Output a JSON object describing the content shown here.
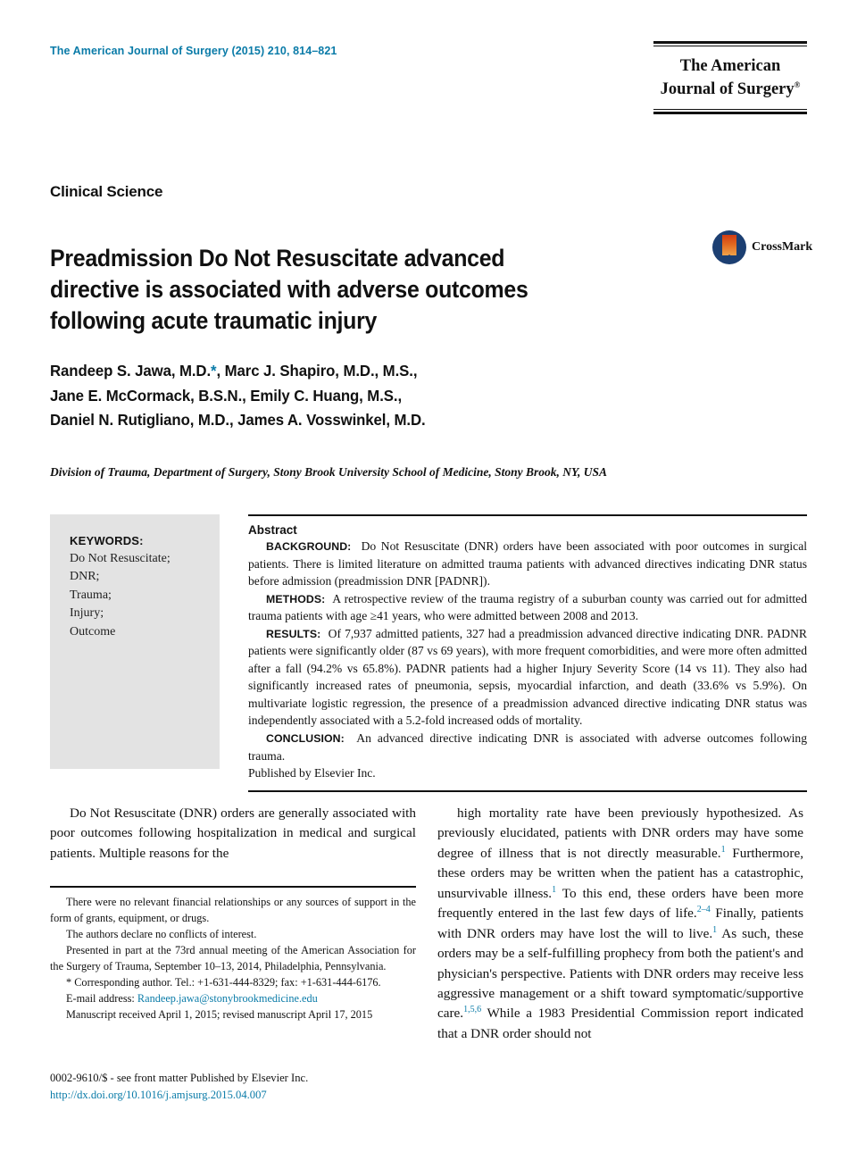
{
  "masthead": {
    "running_head": "The American Journal of Surgery (2015) 210, 814–821",
    "logo_line1": "The American",
    "logo_line2": "Journal of Surgery",
    "logo_registered": "®"
  },
  "article": {
    "section_label": "Clinical Science",
    "title": "Preadmission Do Not Resuscitate advanced directive is associated with adverse outcomes following acute traumatic injury",
    "authors_line1": "Randeep S. Jawa, M.D.",
    "authors_corr_marker": "*",
    "authors_line1_rest": ", Marc J. Shapiro, M.D., M.S.,",
    "authors_line2": "Jane E. McCormack, B.S.N., Emily C. Huang, M.S.,",
    "authors_line3": "Daniel N. Rutigliano, M.D., James A. Vosswinkel, M.D.",
    "affiliation": "Division of Trauma, Department of Surgery, Stony Brook University School of Medicine, Stony Brook, NY, USA"
  },
  "crossmark": {
    "label": "CrossMark"
  },
  "keywords": {
    "title": "KEYWORDS:",
    "items": [
      "Do Not Resuscitate;",
      "DNR;",
      "Trauma;",
      "Injury;",
      "Outcome"
    ]
  },
  "abstract": {
    "heading": "Abstract",
    "sections": [
      {
        "tag": "BACKGROUND:",
        "text": "Do Not Resuscitate (DNR) orders have been associated with poor outcomes in surgical patients. There is limited literature on admitted trauma patients with advanced directives indicating DNR status before admission (preadmission DNR [PADNR])."
      },
      {
        "tag": "METHODS:",
        "text": "A retrospective review of the trauma registry of a suburban county was carried out for admitted trauma patients with age ≥41 years, who were admitted between 2008 and 2013."
      },
      {
        "tag": "RESULTS:",
        "text": "Of 7,937 admitted patients, 327 had a preadmission advanced directive indicating DNR. PADNR patients were significantly older (87 vs 69 years), with more frequent comorbidities, and were more often admitted after a fall (94.2% vs 65.8%). PADNR patients had a higher Injury Severity Score (14 vs 11). They also had significantly increased rates of pneumonia, sepsis, myocardial infarction, and death (33.6% vs 5.9%). On multivariate logistic regression, the presence of a preadmission advanced directive indicating DNR status was independently associated with a 5.2-fold increased odds of mortality."
      },
      {
        "tag": "CONCLUSION:",
        "text": "An advanced directive indicating DNR is associated with adverse outcomes following trauma."
      }
    ],
    "publisher_line": "Published by Elsevier Inc."
  },
  "body": {
    "left_column": "Do Not Resuscitate (DNR) orders are generally associated with poor outcomes following hospitalization in medical and surgical patients. Multiple reasons for the",
    "right_column_parts": [
      {
        "type": "text",
        "value": "high mortality rate have been previously hypothesized. As previously elucidated, patients with DNR orders may have some degree of illness that is not directly measurable."
      },
      {
        "type": "cite",
        "value": "1"
      },
      {
        "type": "text",
        "value": " Furthermore, these orders may be written when the patient has a catastrophic, unsurvivable illness."
      },
      {
        "type": "cite",
        "value": "1"
      },
      {
        "type": "text",
        "value": " To this end, these orders have been more frequently entered in the last few days of life."
      },
      {
        "type": "cite",
        "value": "2–4"
      },
      {
        "type": "text",
        "value": " Finally, patients with DNR orders may have lost the will to live."
      },
      {
        "type": "cite",
        "value": "1"
      },
      {
        "type": "text",
        "value": " As such, these orders may be a self-fulfilling prophecy from both the patient's and physician's perspective. Patients with DNR orders may receive less aggressive management or a shift toward symptomatic/supportive care."
      },
      {
        "type": "cite",
        "value": "1,5,6"
      },
      {
        "type": "text",
        "value": " While a 1983 Presidential Commission report indicated that a DNR order should not"
      }
    ]
  },
  "footnotes": {
    "items": [
      "There were no relevant financial relationships or any sources of support in the form of grants, equipment, or drugs.",
      "The authors declare no conflicts of interest.",
      "Presented in part at the 73rd annual meeting of the American Association for the Surgery of Trauma, September 10–13, 2014, Philadelphia, Pennsylvania."
    ],
    "corresponding_marker": "*",
    "corresponding": "Corresponding author. Tel.: +1-631-444-8329; fax: +1-631-444-6176.",
    "email_label": "E-mail address:",
    "email": "Randeep.jawa@stonybrookmedicine.edu",
    "manuscript_dates": "Manuscript received April 1, 2015; revised manuscript April 17, 2015"
  },
  "colophon": {
    "issn_line": "0002-9610/$ - see front matter Published by Elsevier Inc.",
    "doi": "http://dx.doi.org/10.1016/j.amjsurg.2015.04.007"
  },
  "colors": {
    "accent_teal": "#0a7ba8",
    "keyword_panel_bg": "#e3e3e3",
    "crossmark_circle": "#1c3f72",
    "crossmark_mark": "#d8511a"
  }
}
